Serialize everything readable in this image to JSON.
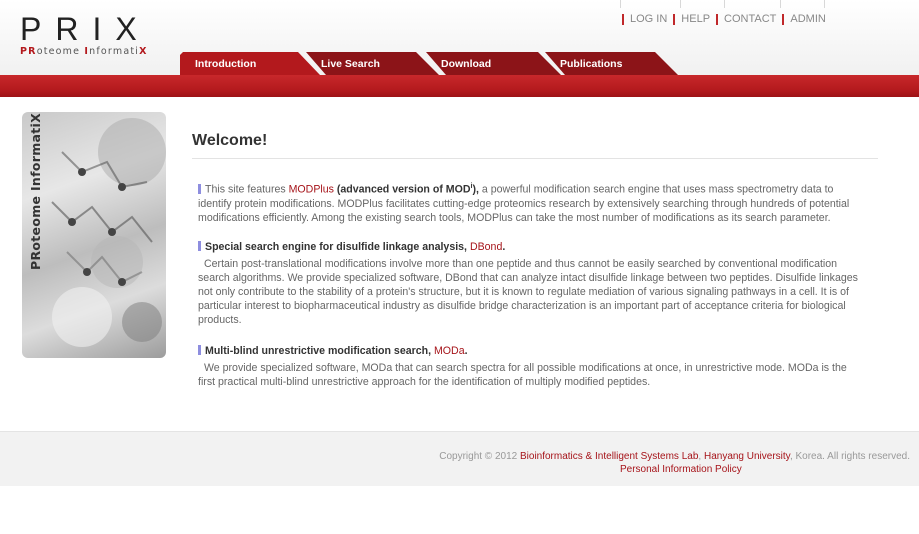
{
  "logo": {
    "title": "PRIX",
    "subtitle_parts": [
      "PR",
      "oteome ",
      "I",
      "nformati",
      "X"
    ]
  },
  "top_nav": [
    "LOG IN",
    "HELP",
    "CONTACT",
    "ADMIN"
  ],
  "tabs": [
    "Introduction",
    "Live Search",
    "Download",
    "Publications"
  ],
  "side_panel": {
    "text": "PRoteome InformatiX"
  },
  "main": {
    "heading": "Welcome!",
    "section1": {
      "prefix": "This site features ",
      "link": "MODPlus",
      "bold": " (advanced version of MOD",
      "sup": "i",
      "bold_close": "),",
      "rest": "   a powerful modification search engine that uses mass spectrometry data to identify protein modifications. MODPlus facilitates cutting-edge proteomics research by extensively searching through hundreds of potential modifications efficiently. Among the existing search tools, MODPlus can take the most number of modifications as its search parameter."
    },
    "section2": {
      "title": "Special search engine for disulfide linkage analysis, ",
      "link": "DBond",
      "title_end": ".",
      "body": "Certain post-translational modifications involve more than one peptide and thus cannot be easily searched by conventional modification search algorithms. We provide specialized software, DBond that can analyze intact disulfide linkage between two peptides. Disulfide linkages not only contribute to the stability of a protein's structure, but it is known to regulate mediation of various signaling pathways in a cell. It is of particular interest to biopharmaceutical industry as disulfide bridge characterization is an important part of acceptance criteria for biological products."
    },
    "section3": {
      "title": "Multi-blind unrestrictive modification search, ",
      "link": "MODa",
      "title_end": ".",
      "body": "We provide specialized software, MODa that can search spectra for all possible modifications at once, in unrestrictive mode. MODa is the first practical multi-blind unrestrictive approach for the identification of multiply modified peptides."
    }
  },
  "footer": {
    "copyright": "Copyright © 2012 ",
    "lab_link": "Bioinformatics & Intelligent Systems Lab",
    "sep": ", ",
    "univ_link": "Hanyang University",
    "suffix": ", Korea. All rights reserved.",
    "policy_link": "Personal Information Policy"
  },
  "colors": {
    "brand_red": "#b3191d",
    "bullet": "#8e8edf",
    "link": "#a6141a"
  }
}
